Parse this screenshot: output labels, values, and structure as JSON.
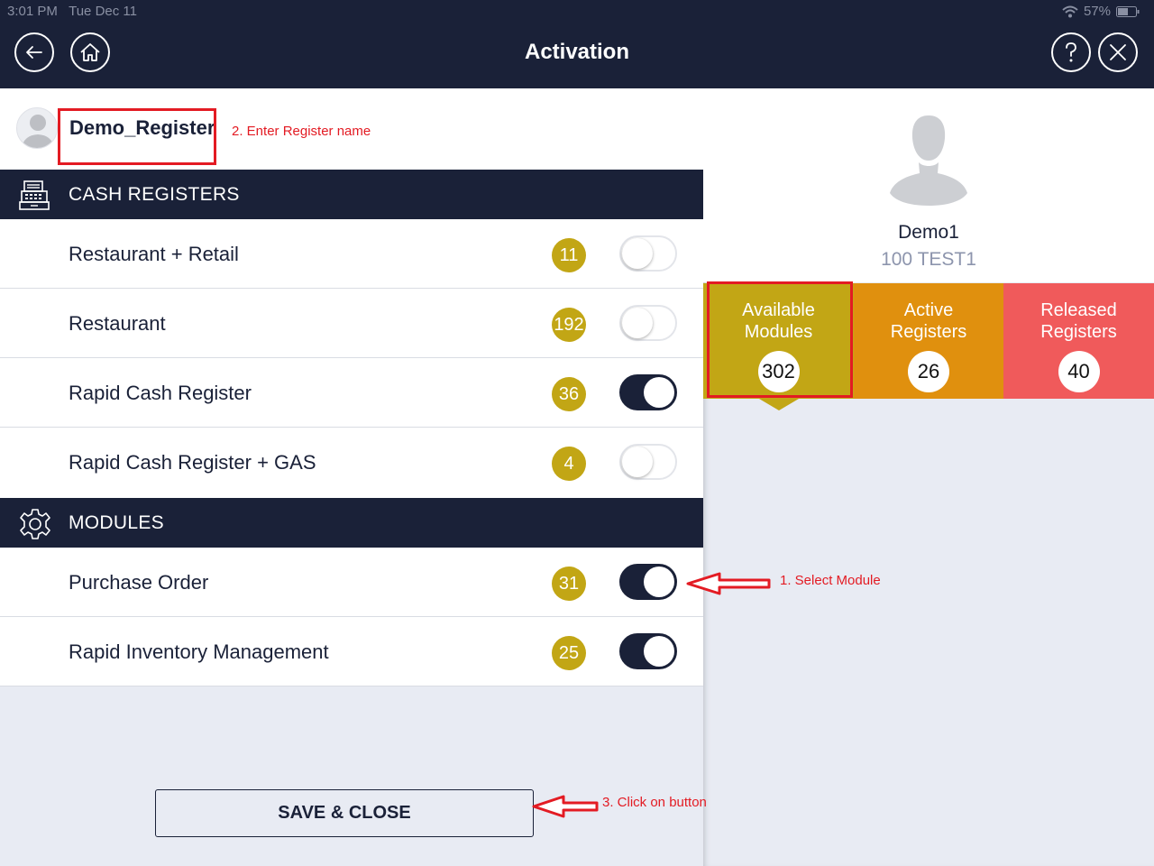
{
  "status_bar": {
    "time": "3:01 PM",
    "date": "Tue Dec 11",
    "battery": "57%"
  },
  "header": {
    "title": "Activation",
    "back_icon": "arrow-left-icon",
    "home_icon": "home-icon",
    "help_icon": "question-icon",
    "close_icon": "close-icon"
  },
  "register": {
    "name": "Demo_Register"
  },
  "annotations": {
    "step1": "1. Select Module",
    "step2": "2. Enter Register name",
    "step3": "3. Click on button"
  },
  "sections": {
    "cash_registers": {
      "title": "CASH REGISTERS",
      "items": [
        {
          "label": "Restaurant + Retail",
          "count": "11",
          "enabled": false
        },
        {
          "label": "Restaurant",
          "count": "192",
          "enabled": false
        },
        {
          "label": "Rapid Cash Register",
          "count": "36",
          "enabled": true
        },
        {
          "label": "Rapid Cash Register + GAS",
          "count": "4",
          "enabled": false
        }
      ]
    },
    "modules": {
      "title": "MODULES",
      "items": [
        {
          "label": "Purchase Order",
          "count": "31",
          "enabled": true
        },
        {
          "label": "Rapid Inventory Management",
          "count": "25",
          "enabled": true
        }
      ]
    }
  },
  "save_button": {
    "label": "SAVE & CLOSE"
  },
  "profile": {
    "name": "Demo1",
    "code": "100 TEST1"
  },
  "stats": [
    {
      "label_line1": "Available",
      "label_line2": "Modules",
      "value": "302",
      "color": "#c2a615"
    },
    {
      "label_line1": "Active",
      "label_line2": "Registers",
      "value": "26",
      "color": "#e0900e"
    },
    {
      "label_line1": "Released",
      "label_line2": "Registers",
      "value": "40",
      "color": "#f05a5b"
    }
  ],
  "colors": {
    "navy": "#1a2138",
    "badge": "#c2a615",
    "annotation": "#e31b23"
  }
}
